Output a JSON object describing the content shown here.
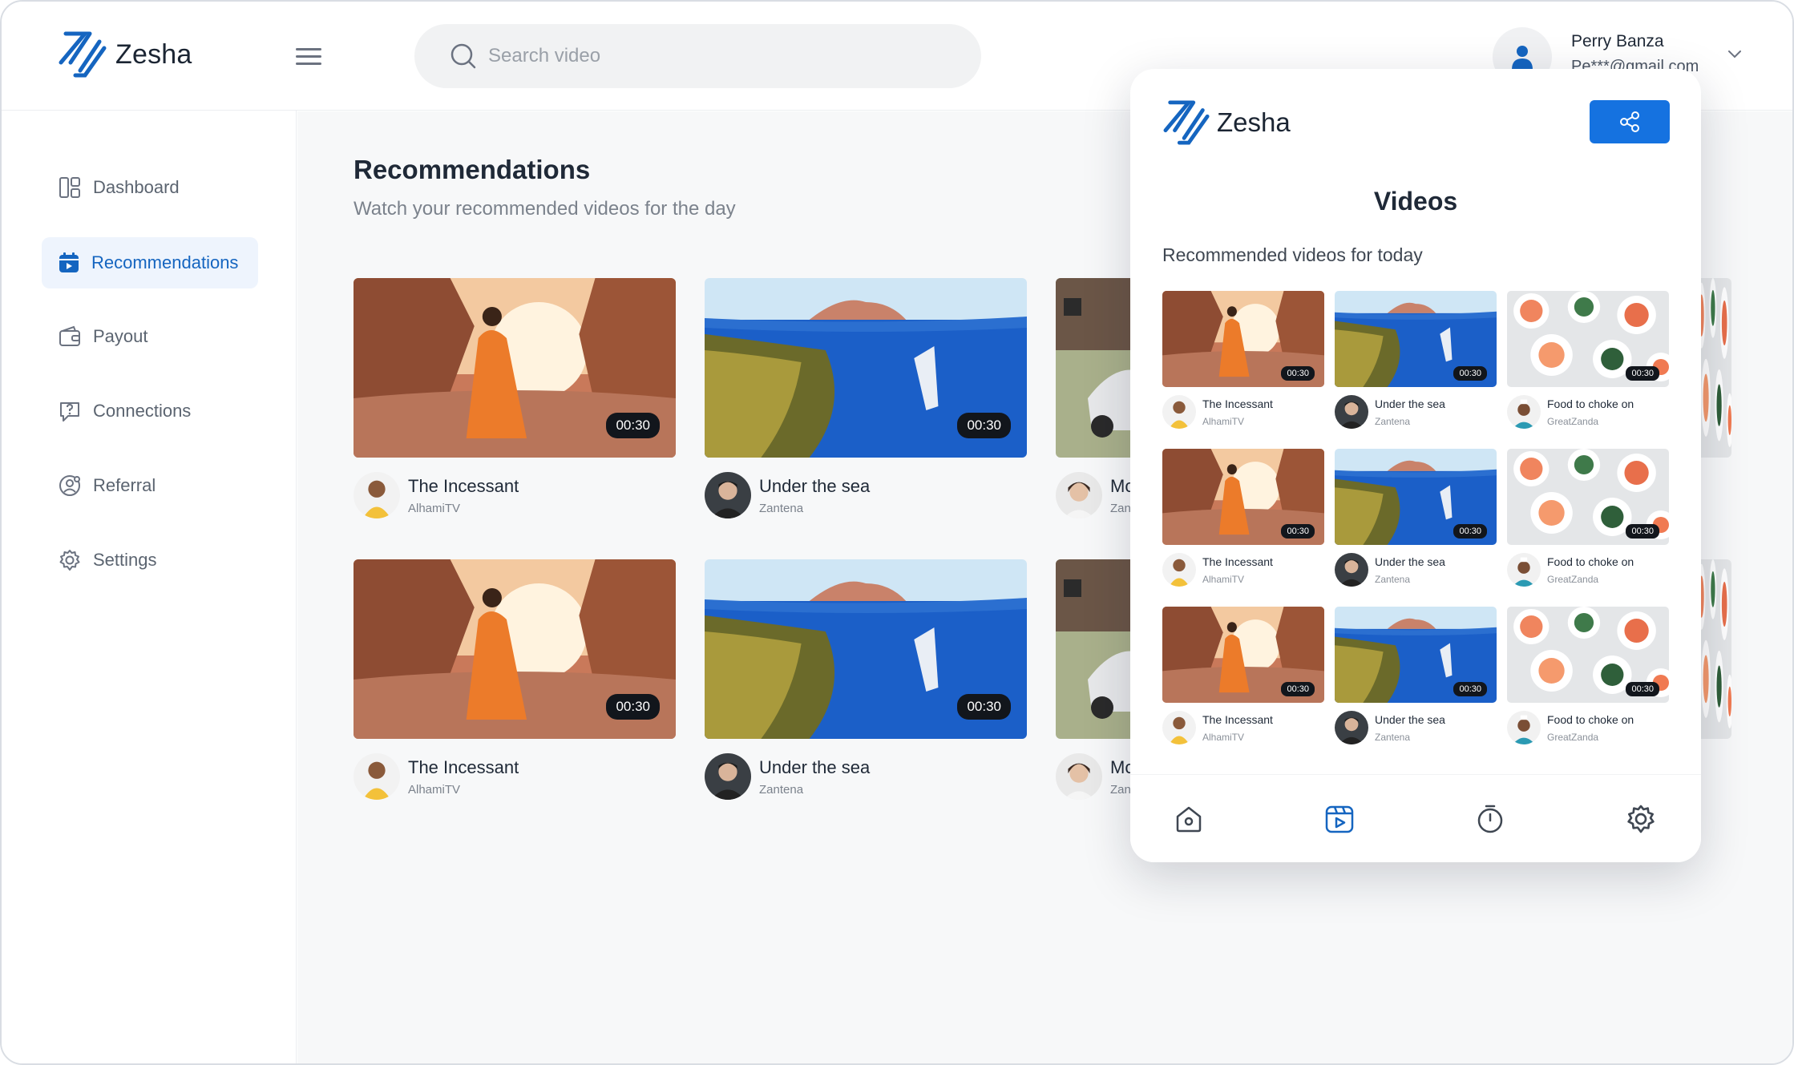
{
  "app": {
    "name": "Zesha"
  },
  "header": {
    "search_placeholder": "Search video",
    "user": {
      "name": "Perry Banza",
      "email": "Pe***@gmail.com"
    }
  },
  "sidebar": {
    "items": [
      {
        "label": "Dashboard",
        "icon": "dashboard-icon",
        "active": false
      },
      {
        "label": "Recommendations",
        "icon": "calendar-play-icon",
        "active": true
      },
      {
        "label": "Payout",
        "icon": "wallet-icon",
        "active": false
      },
      {
        "label": "Connections",
        "icon": "chat-question-icon",
        "active": false
      },
      {
        "label": "Referral",
        "icon": "users-icon",
        "active": false
      },
      {
        "label": "Settings",
        "icon": "gear-icon",
        "active": false
      }
    ]
  },
  "main": {
    "title": "Recommendations",
    "subtitle": "Watch your recommended videos for the day",
    "cards": [
      {
        "title": "The Incessant",
        "channel": "AlhamiTV",
        "duration": "00:30"
      },
      {
        "title": "Under the sea",
        "channel": "Zantena",
        "duration": "00:30"
      },
      {
        "title": "Mo",
        "channel": "Zan",
        "duration": ""
      },
      {
        "title": "The Incessant",
        "channel": "AlhamiTV",
        "duration": "00:30"
      },
      {
        "title": "Under the sea",
        "channel": "Zantena",
        "duration": "00:30"
      },
      {
        "title": "Mo",
        "channel": "Zan",
        "duration": ""
      }
    ]
  },
  "panel": {
    "title": "Videos",
    "subtitle": "Recommended videos for today",
    "videos": [
      {
        "title": "The Incessant",
        "channel": "AlhamiTV",
        "duration": "00:30"
      },
      {
        "title": "Under the sea",
        "channel": "Zantena",
        "duration": "00:30"
      },
      {
        "title": "Food to choke on",
        "channel": "GreatZanda",
        "duration": "00:30"
      },
      {
        "title": "The Incessant",
        "channel": "AlhamiTV",
        "duration": "00:30"
      },
      {
        "title": "Under the sea",
        "channel": "Zantena",
        "duration": "00:30"
      },
      {
        "title": "Food to choke on",
        "channel": "GreatZanda",
        "duration": "00:30"
      },
      {
        "title": "The Incessant",
        "channel": "AlhamiTV",
        "duration": "00:30"
      },
      {
        "title": "Under the sea",
        "channel": "Zantena",
        "duration": "00:30"
      },
      {
        "title": "Food to choke on",
        "channel": "GreatZanda",
        "duration": "00:30"
      }
    ],
    "tabs": [
      {
        "icon": "home-icon",
        "active": false
      },
      {
        "icon": "video-icon",
        "active": true
      },
      {
        "icon": "timer-icon",
        "active": false
      },
      {
        "icon": "gear-icon",
        "active": false
      }
    ]
  },
  "colors": {
    "accent": "#1565c0",
    "share_button": "#1572e0",
    "active_bg": "#eef4fd"
  }
}
